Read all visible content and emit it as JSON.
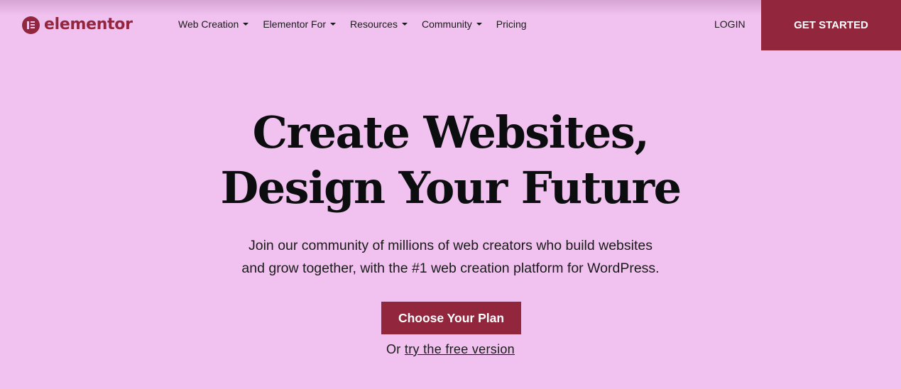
{
  "brand": {
    "name": "elementor",
    "color": "#92263D",
    "background": "#F1C2F0"
  },
  "nav": {
    "items": [
      {
        "label": "Web Creation",
        "has_dropdown": true
      },
      {
        "label": "Elementor For",
        "has_dropdown": true
      },
      {
        "label": "Resources",
        "has_dropdown": true
      },
      {
        "label": "Community",
        "has_dropdown": true
      },
      {
        "label": "Pricing",
        "has_dropdown": false
      }
    ],
    "login_label": "LOGIN",
    "get_started_label": "GET STARTED"
  },
  "hero": {
    "title_line1": "Create Websites,",
    "title_line2": "Design Your Future",
    "subtitle_line1": "Join our community of millions of web creators who build websites",
    "subtitle_line2": "and grow together, with the #1 web creation platform for WordPress.",
    "cta_label": "Choose Your Plan",
    "alt_prefix": "Or",
    "alt_link": "try the free version"
  }
}
